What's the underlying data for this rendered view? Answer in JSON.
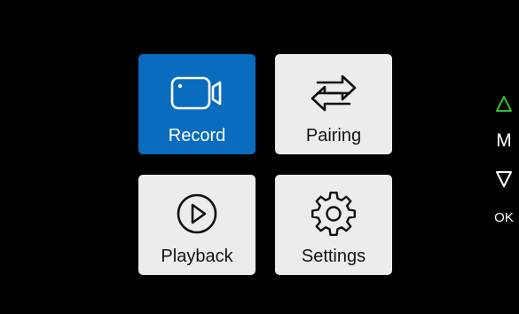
{
  "menu": {
    "tiles": [
      {
        "label": "Record",
        "icon": "video-camera-icon",
        "selected": true
      },
      {
        "label": "Pairing",
        "icon": "swap-arrows-icon",
        "selected": false
      },
      {
        "label": "Playback",
        "icon": "play-circle-icon",
        "selected": false
      },
      {
        "label": "Settings",
        "icon": "gear-icon",
        "selected": false
      }
    ],
    "colors": {
      "selected_tile": "#0a6cbf",
      "tile": "#ececec",
      "background": "#000000"
    }
  },
  "side_keys": {
    "up_icon": "triangle-up-icon",
    "up_color": "#2fbf2f",
    "m_label": "M",
    "down_icon": "triangle-down-icon",
    "ok_label": "OK"
  }
}
